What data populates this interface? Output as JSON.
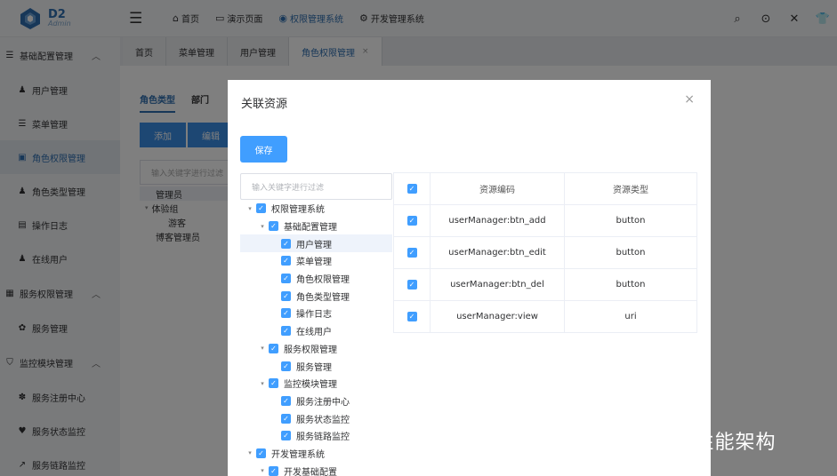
{
  "app": {
    "logo_title": "D2",
    "logo_sub": "Admin"
  },
  "topnav": [
    {
      "icon": "home-icon",
      "glyph": "⌂",
      "label": "首页"
    },
    {
      "icon": "folder-icon",
      "glyph": "▭",
      "label": "演示页面"
    },
    {
      "icon": "settings-icon",
      "glyph": "◉",
      "label": "权限管理系统"
    },
    {
      "icon": "gear-icon",
      "glyph": "⚙",
      "label": "开发管理系统"
    }
  ],
  "sidebar": {
    "group_config": "基础配置管理",
    "items_config": [
      {
        "icon": "user-icon",
        "glyph": "♟",
        "label": "用户管理"
      },
      {
        "icon": "list-icon",
        "glyph": "☰",
        "label": "菜单管理"
      },
      {
        "icon": "id-card-icon",
        "glyph": "▣",
        "label": "角色权限管理"
      },
      {
        "icon": "user-type-icon",
        "glyph": "♟",
        "label": "角色类型管理"
      },
      {
        "icon": "log-icon",
        "glyph": "▤",
        "label": "操作日志"
      },
      {
        "icon": "online-user-icon",
        "glyph": "♟",
        "label": "在线用户"
      }
    ],
    "group_service": "服务权限管理",
    "items_service": [
      {
        "icon": "service-icon",
        "glyph": "✿",
        "label": "服务管理"
      }
    ],
    "group_monitor": "监控模块管理",
    "items_monitor": [
      {
        "icon": "paw-icon",
        "glyph": "✽",
        "label": "服务注册中心"
      },
      {
        "icon": "heartbeat-icon",
        "glyph": "♥",
        "label": "服务状态监控"
      },
      {
        "icon": "line-chart-icon",
        "glyph": "↗",
        "label": "服务链路监控"
      }
    ]
  },
  "tabs": [
    "首页",
    "菜单管理",
    "用户管理",
    "角色权限管理"
  ],
  "main": {
    "subtab_role_type": "角色类型",
    "subtab_dept": "部门",
    "btn_add": "添加",
    "btn_edit": "编辑",
    "filter_placeholder": "输入关键字进行过滤",
    "roles": [
      "管理员",
      "体验组",
      "游客",
      "博客管理员"
    ]
  },
  "dialog": {
    "title": "关联资源",
    "close": "×",
    "save": "保存",
    "tree_filter_placeholder": "输入关键字进行过滤",
    "tree": [
      {
        "label": "权限管理系统",
        "level": 0,
        "caret": true
      },
      {
        "label": "基础配置管理",
        "level": 1,
        "caret": true
      },
      {
        "label": "用户管理",
        "level": 2,
        "caret": false,
        "highlight": true
      },
      {
        "label": "菜单管理",
        "level": 2,
        "caret": false
      },
      {
        "label": "角色权限管理",
        "level": 2,
        "caret": false
      },
      {
        "label": "角色类型管理",
        "level": 2,
        "caret": false
      },
      {
        "label": "操作日志",
        "level": 2,
        "caret": false
      },
      {
        "label": "在线用户",
        "level": 2,
        "caret": false
      },
      {
        "label": "服务权限管理",
        "level": 1,
        "caret": true
      },
      {
        "label": "服务管理",
        "level": 2,
        "caret": false
      },
      {
        "label": "监控模块管理",
        "level": 1,
        "caret": true
      },
      {
        "label": "服务注册中心",
        "level": 2,
        "caret": false
      },
      {
        "label": "服务状态监控",
        "level": 2,
        "caret": false
      },
      {
        "label": "服务链路监控",
        "level": 2,
        "caret": false
      },
      {
        "label": "开发管理系统",
        "level": 0,
        "caret": true
      },
      {
        "label": "开发基础配置",
        "level": 1,
        "caret": true
      }
    ],
    "table": {
      "headers": [
        "资源编码",
        "资源类型"
      ],
      "rows": [
        {
          "code": "userManager:btn_add",
          "type": "button"
        },
        {
          "code": "userManager:btn_edit",
          "type": "button"
        },
        {
          "code": "userManager:btn_del",
          "type": "button"
        },
        {
          "code": "userManager:view",
          "type": "uri"
        }
      ]
    }
  },
  "watermark": "知乎 @Java高性能架构"
}
